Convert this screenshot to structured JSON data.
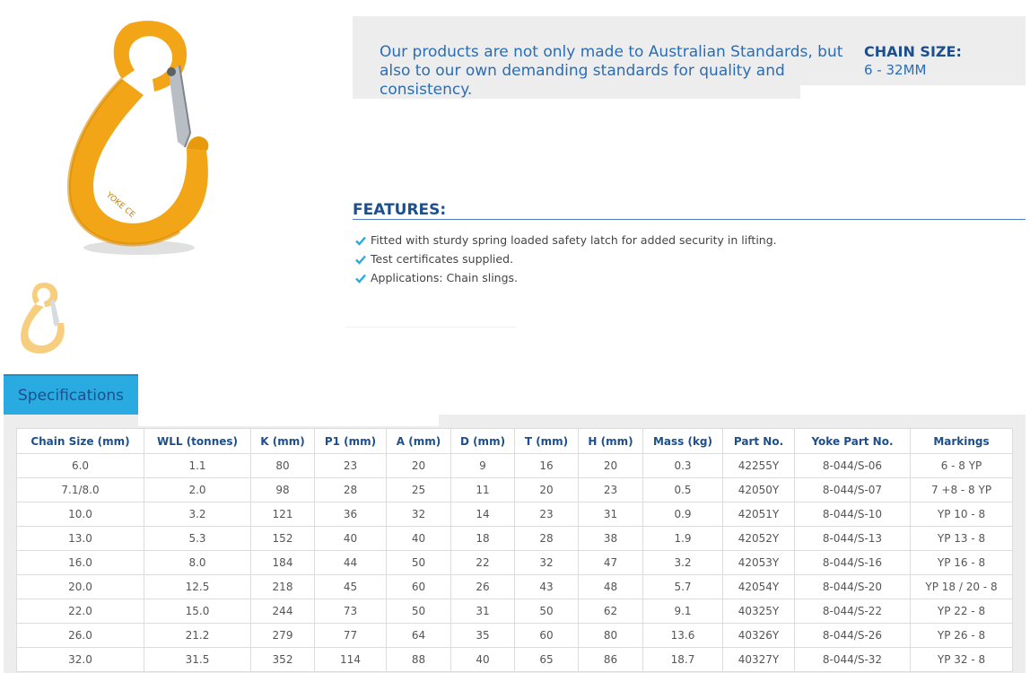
{
  "product": {
    "main_image_alt": "Yellow eye sling hook with safety latch",
    "thumbnail_alt": "Eye sling hook thumbnail",
    "hook_color": "#f2a516",
    "hook_marking": "YOKE CE"
  },
  "intro": {
    "text": "Our products are not only made to Australian Standards, but also to our own demanding standards for quality and consistency.",
    "chain_size_label": "CHAIN SIZE:",
    "chain_size_value": "6 - 32MM"
  },
  "features": {
    "title": "FEATURES:",
    "items": [
      "Fitted with sturdy spring loaded safety latch for added security in lifting.",
      "Test certificates supplied.",
      "Applications: Chain slings."
    ],
    "check_icon": "check-icon"
  },
  "tabs": {
    "specifications_label": "Specifications"
  },
  "colors": {
    "accent_blue": "#29abe2",
    "heading_blue": "#1c4f8c",
    "text_blue": "#2a6db5",
    "panel_grey": "#ededed"
  },
  "table": {
    "headers": [
      "Chain Size (mm)",
      "WLL (tonnes)",
      "K (mm)",
      "P1 (mm)",
      "A (mm)",
      "D (mm)",
      "T (mm)",
      "H (mm)",
      "Mass (kg)",
      "Part No.",
      "Yoke Part No.",
      "Markings"
    ],
    "rows": [
      [
        "6.0",
        "1.1",
        "80",
        "23",
        "20",
        "9",
        "16",
        "20",
        "0.3",
        "42255Y",
        "8-044/S-06",
        "6 - 8 YP"
      ],
      [
        "7.1/8.0",
        "2.0",
        "98",
        "28",
        "25",
        "11",
        "20",
        "23",
        "0.5",
        "42050Y",
        "8-044/S-07",
        "7 +8 - 8 YP"
      ],
      [
        "10.0",
        "3.2",
        "121",
        "36",
        "32",
        "14",
        "23",
        "31",
        "0.9",
        "42051Y",
        "8-044/S-10",
        "YP 10 - 8"
      ],
      [
        "13.0",
        "5.3",
        "152",
        "40",
        "40",
        "18",
        "28",
        "38",
        "1.9",
        "42052Y",
        "8-044/S-13",
        "YP 13 - 8"
      ],
      [
        "16.0",
        "8.0",
        "184",
        "44",
        "50",
        "22",
        "32",
        "47",
        "3.2",
        "42053Y",
        "8-044/S-16",
        "YP 16 - 8"
      ],
      [
        "20.0",
        "12.5",
        "218",
        "45",
        "60",
        "26",
        "43",
        "48",
        "5.7",
        "42054Y",
        "8-044/S-20",
        "YP 18 / 20 - 8"
      ],
      [
        "22.0",
        "15.0",
        "244",
        "73",
        "50",
        "31",
        "50",
        "62",
        "9.1",
        "40325Y",
        "8-044/S-22",
        "YP 22 - 8"
      ],
      [
        "26.0",
        "21.2",
        "279",
        "77",
        "64",
        "35",
        "60",
        "80",
        "13.6",
        "40326Y",
        "8-044/S-26",
        "YP 26 - 8"
      ],
      [
        "32.0",
        "31.5",
        "352",
        "114",
        "88",
        "40",
        "65",
        "86",
        "18.7",
        "40327Y",
        "8-044/S-32",
        "YP 32 - 8"
      ]
    ]
  }
}
